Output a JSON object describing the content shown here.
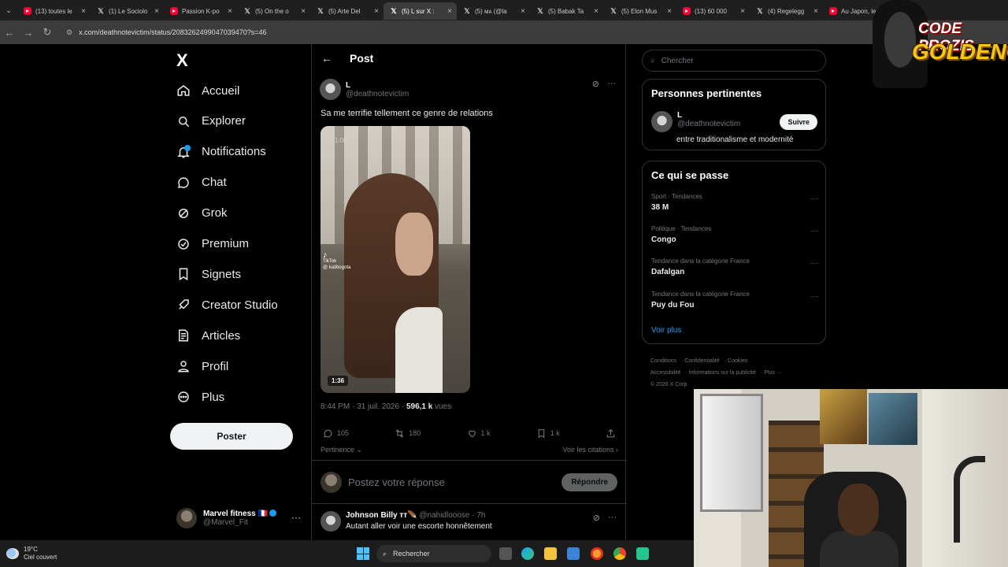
{
  "browser": {
    "tabs": [
      {
        "label": "(13) toutes le",
        "favicon": "youtube-icon",
        "active": false
      },
      {
        "label": "(1) Le Sociolo",
        "favicon": "x-icon",
        "active": false
      },
      {
        "label": "Passion K-po",
        "favicon": "youtube-icon",
        "active": false
      },
      {
        "label": "(5) On the o",
        "favicon": "x-icon",
        "active": false
      },
      {
        "label": "(5) Arte Del",
        "favicon": "x-icon",
        "active": false
      },
      {
        "label": "(5) L sur X :",
        "favicon": "x-icon",
        "active": true
      },
      {
        "label": "(5) ᴍᴀ (@la",
        "favicon": "x-icon",
        "active": false
      },
      {
        "label": "(5) Babak Ta",
        "favicon": "x-icon",
        "active": false
      },
      {
        "label": "(5) Elon Mus",
        "favicon": "x-icon",
        "active": false
      },
      {
        "label": "(13) 60 000",
        "favicon": "youtube-icon",
        "active": false
      },
      {
        "label": "(4) Regelegg",
        "favicon": "x-icon",
        "active": false
      },
      {
        "label": "Au Japon, le",
        "favicon": "youtube-icon",
        "active": false
      }
    ],
    "url": "x.com/deathnotevictim/status/2083262499047039470?s=46"
  },
  "nav": {
    "logo": "X",
    "items": [
      {
        "label": "Accueil",
        "icon": "home-icon"
      },
      {
        "label": "Explorer",
        "icon": "search-icon"
      },
      {
        "label": "Notifications",
        "icon": "bell-icon"
      },
      {
        "label": "Chat",
        "icon": "chat-icon"
      },
      {
        "label": "Grok",
        "icon": "grok-icon"
      },
      {
        "label": "Premium",
        "icon": "premium-icon"
      },
      {
        "label": "Signets",
        "icon": "bookmark-icon"
      },
      {
        "label": "Creator Studio",
        "icon": "rocket-icon"
      },
      {
        "label": "Articles",
        "icon": "article-icon"
      },
      {
        "label": "Profil",
        "icon": "profile-icon"
      },
      {
        "label": "Plus",
        "icon": "more-circle-icon"
      }
    ],
    "post_button": "Poster",
    "account": {
      "name": "Marvel fitness 🇫🇷",
      "handle": "@Marvel_Fit"
    }
  },
  "post": {
    "header_title": "Post",
    "author_name": "L",
    "author_handle": "@deathnotevictim",
    "text": "Sa me terrifie tellement ce genre de relations",
    "video_time_top": "1:00",
    "tiktok_label": "TikTok",
    "tiktok_handle": "@ katibogota",
    "video_duration": "1:36",
    "time": "8:44 PM · 31 juil. 2026 · ",
    "views_count": "596,1 k",
    "views_label": " vues",
    "stats": {
      "replies": "105",
      "reposts": "180",
      "likes": "1 k",
      "bookmarks": "1 k"
    },
    "sort_label": "Pertinence ⌄",
    "quotes_label": "Voir les citations ›",
    "reply_placeholder": "Postez votre réponse",
    "reply_button": "Répondre"
  },
  "reply": {
    "name": "Johnson Billy ᴛᴛ🪶",
    "handle_time": "@nahidlooose · 7h",
    "text": "Autant aller voir une escorte honnêtement"
  },
  "sidebar": {
    "search_placeholder": "Chercher",
    "relevant_title": "Personnes pertinentes",
    "relevant_name": "L",
    "relevant_handle": "@deathnotevictim",
    "relevant_bio": "entre traditionalisme et modernité",
    "follow_label": "Suivre",
    "trending_title": "Ce qui se passe",
    "trends": [
      {
        "context": "Sport · Tendances",
        "title": "38 M"
      },
      {
        "context": "Politique · Tendances",
        "title": "Congo"
      },
      {
        "context": "Tendance dans la catégorie France",
        "title": "Dafalgan"
      },
      {
        "context": "Tendance dans la catégorie France",
        "title": "Puy du Fou"
      }
    ],
    "show_more": "Voir plus",
    "footer": [
      "Conditions",
      "Confidentialité",
      "Cookies",
      "Accessibilité",
      "Informations sur la publicité",
      "Plus ···",
      "© 2026 X Corp."
    ]
  },
  "overlay": {
    "line1": "CODE PROZIS",
    "line2": "GOLDENG"
  },
  "taskbar": {
    "temp": "19°C",
    "weather": "Ciel couvert",
    "search": "Rechercher"
  },
  "colors": {
    "accent": "#1d9bf0",
    "background": "#000000",
    "border": "#2f3336"
  }
}
